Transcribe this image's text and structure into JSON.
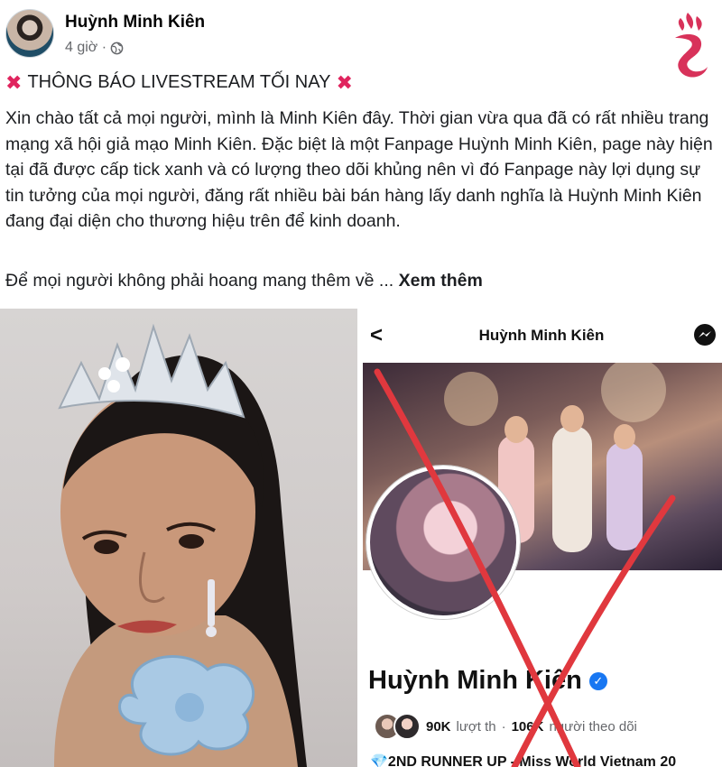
{
  "post": {
    "author": "Huỳnh Minh Kiên",
    "time": "4 giờ ·",
    "title": "THÔNG BÁO LIVESTREAM TỐI NAY",
    "body": "Xin chào tất cả mọi người, mình là Minh Kiên đây. Thời gian vừa qua đã có rất nhiều trang mạng xã hội giả mạo Minh Kiên. Đặc biệt là một Fanpage Huỳnh Minh Kiên, page này hiện tại đã được cấp tick xanh và có lượng theo dõi khủng nên vì đó Fanpage này lợi dụng sự tin tưởng của mọi người, đăng rất nhiều bài bán hàng lấy danh nghĩa là Huỳnh Minh Kiên đang đại diện cho thương hiệu trên để kinh doanh.",
    "more_text": "Để mọi người không phải hoang mang thêm về ...",
    "see_more_label": "Xem thêm"
  },
  "screenshot": {
    "back_glyph": "<",
    "header_title": "Huỳnh Minh Kiên",
    "page_name": "Huỳnh Minh Kiên",
    "likes_count": "90K",
    "likes_label": "lượt th",
    "followers_count": "106K",
    "followers_label": "người theo dõi",
    "bio": "💎2ND RUNNER UP - Miss World Vietnam 20"
  },
  "colors": {
    "x_mark": "#e0245e",
    "verified": "#1877f2",
    "logo": "#d8325a"
  },
  "icons": [
    "globe-icon",
    "x-mark-icon",
    "back-icon",
    "messenger-icon",
    "verified-icon",
    "brand-logo"
  ]
}
